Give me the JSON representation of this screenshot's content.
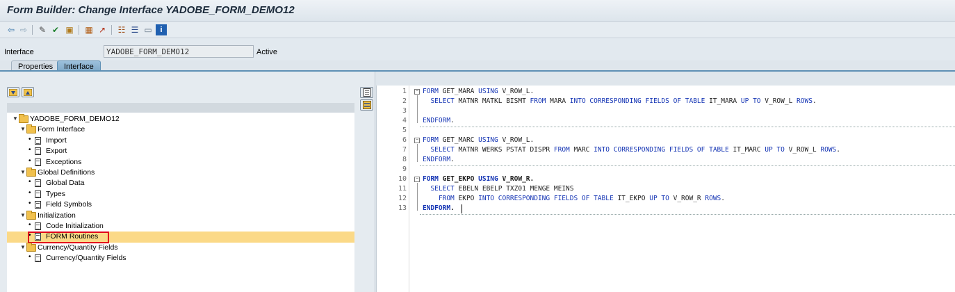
{
  "window": {
    "title": "Form Builder: Change Interface YADOBE_FORM_DEMO12"
  },
  "toolbar": {
    "icons": [
      "back-icon",
      "forward-icon",
      "change-display-icon",
      "activate-icon",
      "check-icon",
      "other-object-icon",
      "copy-icon",
      "where-used-icon",
      "hierarchy-icon",
      "stack-icon",
      "layout-icon",
      "info-icon"
    ]
  },
  "header": {
    "interface_label": "Interface",
    "interface_value": "YADOBE_FORM_DEMO12",
    "status": "Active"
  },
  "tabs": [
    {
      "label": "Properties",
      "active": false
    },
    {
      "label": "Interface",
      "active": true
    }
  ],
  "tree": {
    "root": "YADOBE_FORM_DEMO12",
    "items": [
      {
        "label": "Form Interface",
        "type": "folder"
      },
      {
        "label": "Import",
        "type": "doc"
      },
      {
        "label": "Export",
        "type": "doc"
      },
      {
        "label": "Exceptions",
        "type": "doc"
      },
      {
        "label": "Global Definitions",
        "type": "folder"
      },
      {
        "label": "Global Data",
        "type": "doc"
      },
      {
        "label": "Types",
        "type": "doc"
      },
      {
        "label": "Field Symbols",
        "type": "doc"
      },
      {
        "label": "Initialization",
        "type": "folder"
      },
      {
        "label": "Code Initialization",
        "type": "doc"
      },
      {
        "label": "FORM Routines",
        "type": "doc",
        "selected": true
      },
      {
        "label": "Currency/Quantity Fields",
        "type": "folder"
      },
      {
        "label": "Currency/Quantity Fields",
        "type": "doc"
      }
    ]
  },
  "editor": {
    "line_numbers": [
      "1",
      "2",
      "3",
      "4",
      "5",
      "6",
      "7",
      "8",
      "9",
      "10",
      "11",
      "12",
      "13"
    ],
    "lines": [
      "FORM GET_MARA USING V_ROW_L.",
      "  SELECT MATNR MATKL BISMT FROM MARA INTO CORRESPONDING FIELDS OF TABLE IT_MARA UP TO V_ROW_L ROWS.",
      "",
      "ENDFORM.",
      "",
      "FORM GET_MARC USING V_ROW_L.",
      "  SELECT MATNR WERKS PSTAT DISPR FROM MARC INTO CORRESPONDING FIELDS OF TABLE IT_MARC UP TO V_ROW_L ROWS.",
      "ENDFORM.",
      "",
      "FORM GET_EKPO USING V_ROW_R.",
      "  SELECT EBELN EBELP TXZ01 MENGE MEINS",
      "    FROM EKPO INTO CORRESPONDING FIELDS OF TABLE IT_EKPO UP TO V_ROW_R ROWS.",
      "ENDFORM."
    ]
  }
}
